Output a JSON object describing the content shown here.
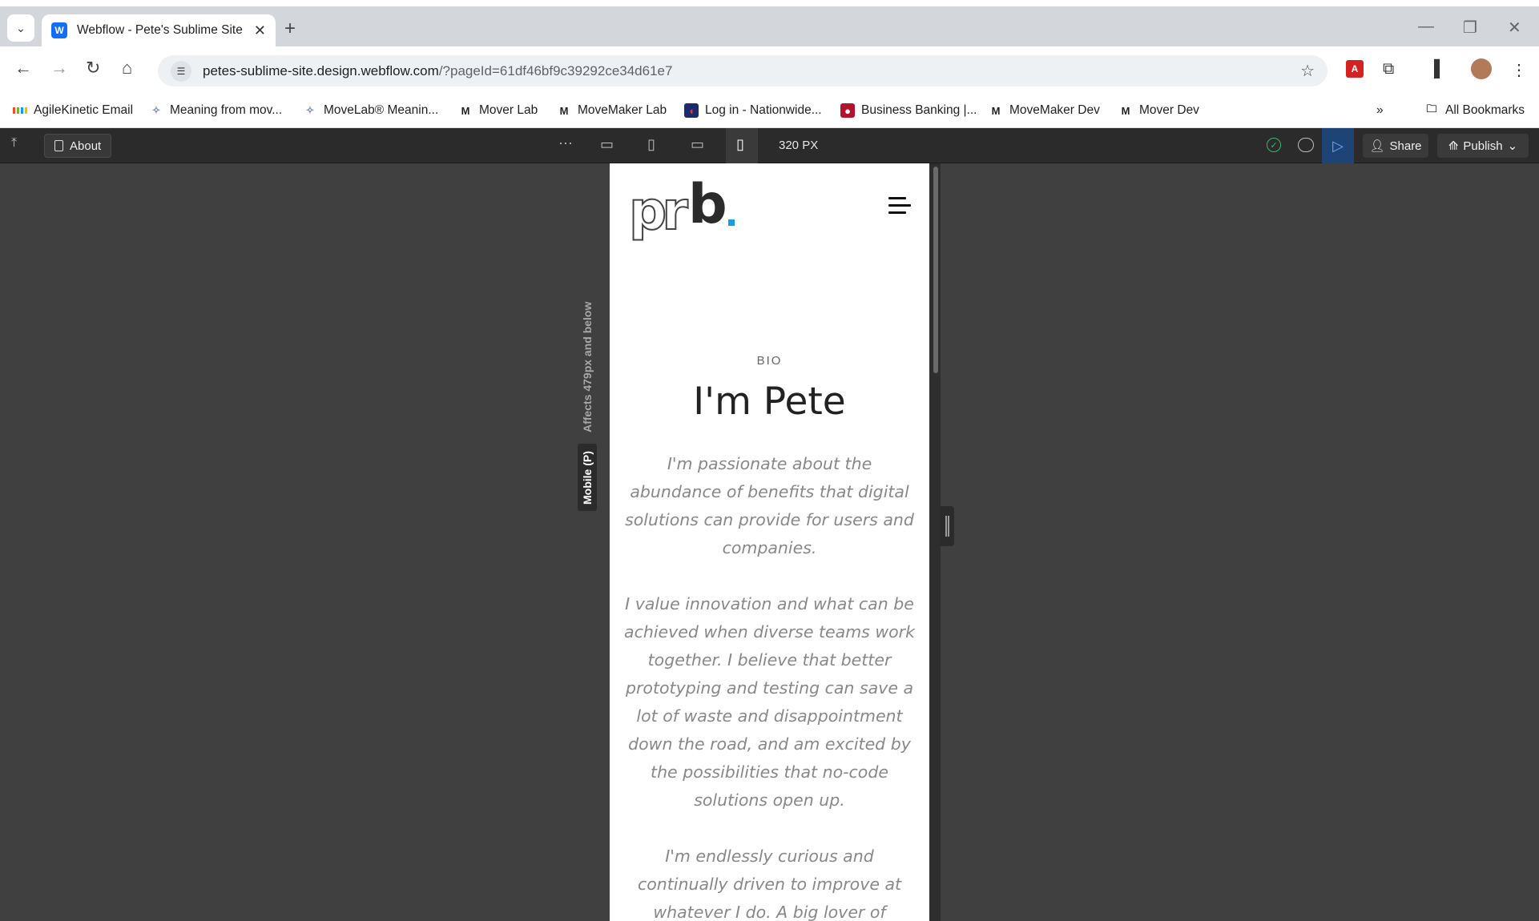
{
  "browser": {
    "tab_title": "Webflow - Pete's Sublime Site",
    "tab_favicon": "W",
    "url_host": "petes-sublime-site.design.webflow.com",
    "url_path": "/?pageId=61df46bf9c39292ce34d61e7",
    "bookmarks": [
      {
        "label": "AgileKinetic Email",
        "icon": "microsoft-icon"
      },
      {
        "label": "Meaning from mov...",
        "icon": "movelab-icon"
      },
      {
        "label": "MoveLab® Meanin...",
        "icon": "movelab-icon"
      },
      {
        "label": "Mover Lab",
        "icon": "m-icon"
      },
      {
        "label": "MoveMaker Lab",
        "icon": "m-icon"
      },
      {
        "label": "Log in - Nationwide...",
        "icon": "nationwide-icon"
      },
      {
        "label": "Business Banking |...",
        "icon": "bank-icon"
      },
      {
        "label": "MoveMaker Dev",
        "icon": "m-icon"
      },
      {
        "label": "Mover Dev",
        "icon": "m-icon"
      }
    ],
    "all_bookmarks": "All Bookmarks"
  },
  "webflow": {
    "page_button": "About",
    "more": "···",
    "width_label": "320 PX",
    "share": "Share",
    "publish": "Publish",
    "breakpoint_label": "Mobile (P)",
    "breakpoint_hint": "Affects 479px and below"
  },
  "site": {
    "logo_text_a": "pr",
    "logo_text_b": "b",
    "kicker": "BIO",
    "title": "I'm Pete",
    "paragraphs": [
      "I'm passionate about the abundance of benefits that digital solutions can provide for users and companies.",
      "I value innovation and what can be achieved when diverse teams work together. I believe that better prototyping and testing can save a lot of waste and disappointment down the road, and am excited by the possibilities that no-code solutions open up.",
      "I'm endlessly curious and continually driven to improve at whatever I do. A big lover of"
    ]
  },
  "colors": {
    "webflow_bar": "#2b2b2b",
    "canvas": "#404040",
    "accent_blue": "#1d4475",
    "logo_dot": "#1a9de0"
  }
}
